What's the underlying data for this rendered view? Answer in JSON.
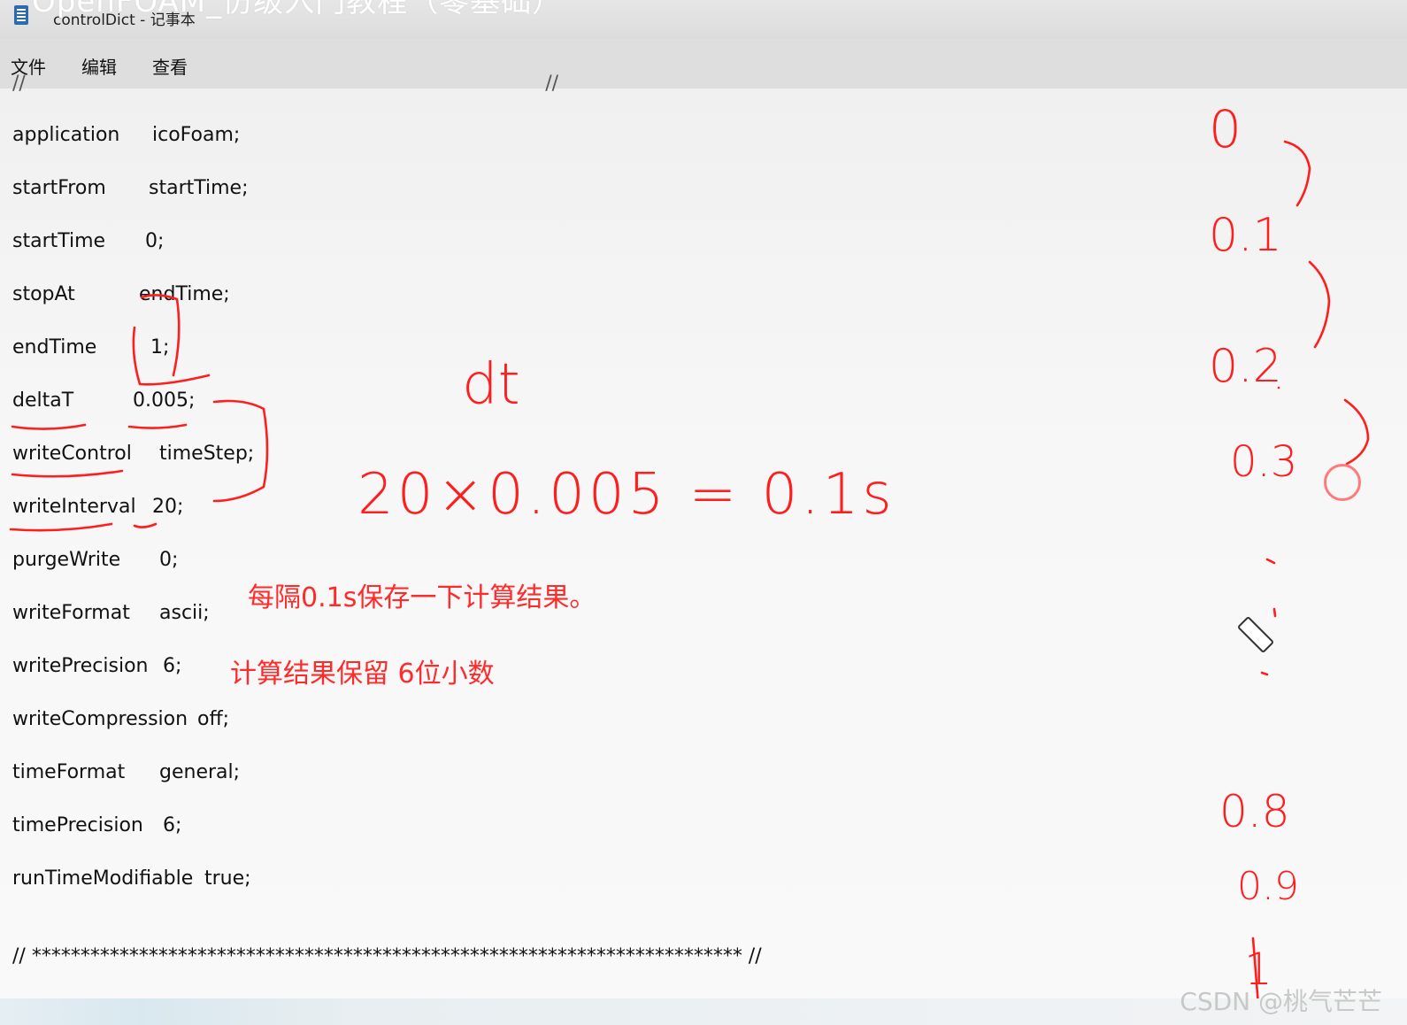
{
  "overlay_title": "OpenFOAM_仿级入门教程（零基础）",
  "window": {
    "title": "controlDict - 记事本",
    "icon": "notepad-icon"
  },
  "menubar": {
    "file": "文件",
    "edit": "编辑",
    "view": "查看"
  },
  "editor": {
    "top_comment": "//                                                                                    //",
    "lines": [
      {
        "key": "application",
        "value": "icoFoam;"
      },
      {
        "key": "startFrom",
        "value": "startTime;"
      },
      {
        "key": "startTime",
        "value": "0;"
      },
      {
        "key": "stopAt",
        "value": "endTime;"
      },
      {
        "key": "endTime",
        "value": "1;"
      },
      {
        "key": "deltaT",
        "value": "0.005;"
      },
      {
        "key": "writeControl",
        "value": "timeStep;"
      },
      {
        "key": "writeInterval",
        "value": "20;"
      },
      {
        "key": "purgeWrite",
        "value": "0;"
      },
      {
        "key": "writeFormat",
        "value": "ascii;"
      },
      {
        "key": "writePrecision",
        "value": "6;"
      },
      {
        "key": "writeCompression",
        "value": "off;"
      },
      {
        "key": "timeFormat",
        "value": "general;"
      },
      {
        "key": "timePrecision",
        "value": "6;"
      },
      {
        "key": "runTimeModifiable",
        "value": "true;"
      }
    ],
    "footer_comment": "// ************************************************************************* //"
  },
  "annotations": {
    "note_save": "每隔0.1s保存一下计算结果。",
    "note_precision": "计算结果保留 6位小数",
    "handwritten_dt": "dt",
    "handwritten_formula": "20×0.005 = 0.1s",
    "timeline": [
      "0",
      "0.1",
      "0.2",
      "0.3",
      "0.8",
      "0.9",
      "1"
    ],
    "ink_color": "#ff1e1e"
  },
  "watermark": "CSDN @桃气芒芒"
}
